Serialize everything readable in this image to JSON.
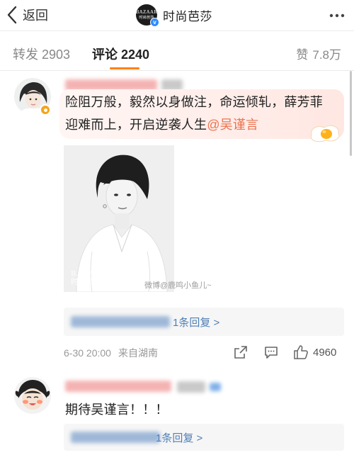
{
  "header": {
    "back_label": "返回",
    "account_name": "时尚芭莎",
    "logo_text": "BAZAAR",
    "logo_sub": "时尚芭莎",
    "verified_mark": "v"
  },
  "tabs": {
    "repost": {
      "label": "转发",
      "count": "2903"
    },
    "comment": {
      "label": "评论",
      "count": "2240"
    },
    "like": {
      "label": "赞",
      "count": "7.8万"
    }
  },
  "comments": [
    {
      "text": "险阻万般，毅然以身做注，命运倾轧，薛芳菲迎难而上，开启逆袭人生",
      "mention": "@吴谨言",
      "photo_caption_top": "BAZAAR",
      "photo_caption_bottom": "时尚芭莎",
      "photo_watermark": "微博@鹿鸣小鱼儿~",
      "replies_link": "1条回复 >",
      "date": "6-30 20:00",
      "source": "来自湖南",
      "like_count": "4960"
    },
    {
      "text": "期待吴谨言！！！",
      "replies_link": "1条回复 >"
    }
  ],
  "colors": {
    "accent": "#ff8200",
    "link": "#4f7fb6",
    "mention": "#eb7350",
    "muted": "#999999",
    "vip_badge": "#f6a31a",
    "verified_badge": "#2f8cff"
  },
  "icons": {
    "back": "chevron-left-icon",
    "more": "more-dots-icon",
    "share": "share-icon",
    "comment": "comment-icon",
    "like": "thumbs-up-icon",
    "egg": "egg-sticker-icon"
  }
}
